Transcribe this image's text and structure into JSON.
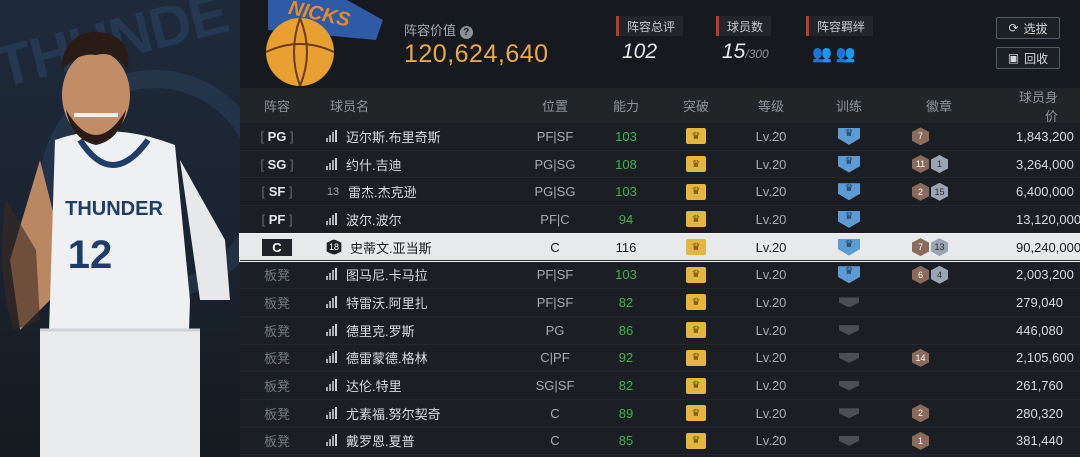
{
  "hero": {
    "team_text": "THUNDER",
    "jersey_number": "12",
    "bg_word": "THUNDE"
  },
  "header": {
    "value_label": "阵容价值",
    "value": "120,624,640",
    "rating_label": "阵容总评",
    "rating": "102",
    "count_label": "球员数",
    "count": "15",
    "count_max": "/300",
    "chem_label": "阵容羁绊",
    "btn_select": "选拔",
    "btn_recycle": "回收"
  },
  "table": {
    "columns": [
      "阵容",
      "球员名",
      "位置",
      "能力",
      "突破",
      "等级",
      "训练",
      "徽章",
      "球员身价"
    ],
    "rows": [
      {
        "slot": "PG",
        "bench": false,
        "icon": "signal",
        "name": "迈尔斯.布里奇斯",
        "pos": "PF|SF",
        "ovr": "103",
        "ovr_green": true,
        "level": "Lv.20",
        "train": "blue",
        "badges": [
          {
            "t": "br",
            "n": "7"
          }
        ],
        "value": "1,843,200",
        "selected": false
      },
      {
        "slot": "SG",
        "bench": false,
        "icon": "signal",
        "name": "约什.吉迪",
        "pos": "PG|SG",
        "ovr": "108",
        "ovr_green": true,
        "level": "Lv.20",
        "train": "blue",
        "badges": [
          {
            "t": "br",
            "n": "11"
          },
          {
            "t": "sv",
            "n": "1"
          }
        ],
        "value": "3,264,000",
        "selected": false
      },
      {
        "slot": "SF",
        "bench": false,
        "icon": "13",
        "name": "雷杰.杰克逊",
        "pos": "PG|SG",
        "ovr": "103",
        "ovr_green": true,
        "level": "Lv.20",
        "train": "blue",
        "badges": [
          {
            "t": "br",
            "n": "2"
          },
          {
            "t": "sv",
            "n": "15"
          }
        ],
        "value": "6,400,000",
        "selected": false
      },
      {
        "slot": "PF",
        "bench": false,
        "icon": "signal",
        "name": "波尔.波尔",
        "pos": "PF|C",
        "ovr": "94",
        "ovr_green": true,
        "level": "Lv.20",
        "train": "blue",
        "badges": [],
        "value": "13,120,000",
        "selected": false
      },
      {
        "slot": "C",
        "bench": false,
        "icon": "18",
        "name": "史蒂文.亚当斯",
        "pos": "C",
        "ovr": "116",
        "ovr_green": false,
        "level": "Lv.20",
        "train": "blue",
        "badges": [
          {
            "t": "br",
            "n": "7"
          },
          {
            "t": "sv",
            "n": "13"
          }
        ],
        "value": "90,240,000",
        "selected": true
      },
      {
        "slot": "板凳",
        "bench": true,
        "icon": "signal",
        "name": "图马尼.卡马拉",
        "pos": "PF|SF",
        "ovr": "103",
        "ovr_green": true,
        "level": "Lv.20",
        "train": "blue",
        "badges": [
          {
            "t": "br",
            "n": "6"
          },
          {
            "t": "sv",
            "n": "4"
          }
        ],
        "value": "2,003,200",
        "selected": false
      },
      {
        "slot": "板凳",
        "bench": true,
        "icon": "signal",
        "name": "特雷沃.阿里扎",
        "pos": "PF|SF",
        "ovr": "82",
        "ovr_green": true,
        "level": "Lv.20",
        "train": "grey",
        "badges": [],
        "value": "279,040",
        "selected": false
      },
      {
        "slot": "板凳",
        "bench": true,
        "icon": "signal",
        "name": "德里克.罗斯",
        "pos": "PG",
        "ovr": "86",
        "ovr_green": true,
        "level": "Lv.20",
        "train": "grey",
        "badges": [],
        "value": "446,080",
        "selected": false
      },
      {
        "slot": "板凳",
        "bench": true,
        "icon": "signal",
        "name": "德雷蒙德.格林",
        "pos": "C|PF",
        "ovr": "92",
        "ovr_green": true,
        "level": "Lv.20",
        "train": "grey",
        "badges": [
          {
            "t": "br",
            "n": "14"
          }
        ],
        "value": "2,105,600",
        "selected": false
      },
      {
        "slot": "板凳",
        "bench": true,
        "icon": "signal",
        "name": "达伦.特里",
        "pos": "SG|SF",
        "ovr": "82",
        "ovr_green": true,
        "level": "Lv.20",
        "train": "grey",
        "badges": [],
        "value": "261,760",
        "selected": false
      },
      {
        "slot": "板凳",
        "bench": true,
        "icon": "signal",
        "name": "尤素福.努尔契奇",
        "pos": "C",
        "ovr": "89",
        "ovr_green": true,
        "level": "Lv.20",
        "train": "grey",
        "badges": [
          {
            "t": "br",
            "n": "2"
          }
        ],
        "value": "280,320",
        "selected": false
      },
      {
        "slot": "板凳",
        "bench": true,
        "icon": "signal",
        "name": "戴罗恩.夏普",
        "pos": "C",
        "ovr": "85",
        "ovr_green": true,
        "level": "Lv.20",
        "train": "grey",
        "badges": [
          {
            "t": "br",
            "n": "1"
          }
        ],
        "value": "381,440",
        "selected": false
      }
    ]
  },
  "colors": {
    "accent_gold": "#e9a94a",
    "ovr_green": "#3fb34d",
    "stat_red": "#c0392b",
    "train_blue": "#5d9bd3"
  }
}
